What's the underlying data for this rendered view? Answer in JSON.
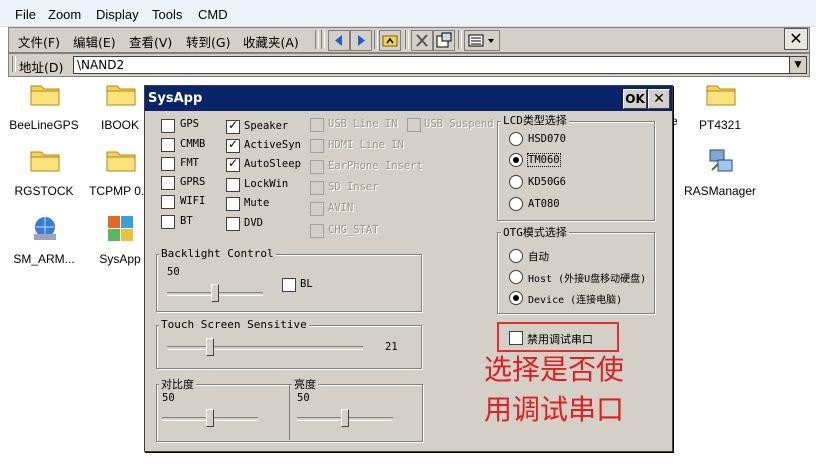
{
  "top_menu": [
    "File",
    "Zoom",
    "Display",
    "Tools",
    "CMD"
  ],
  "explorer": {
    "menu": [
      "文件(F)",
      "编辑(E)",
      "查看(V)",
      "转到(G)",
      "收藏夹(A)"
    ],
    "close_label": "✕",
    "address_label": "地址(D)",
    "address_value": "\\NAND2"
  },
  "desktop_icons": [
    {
      "label": "BeeLineGPS",
      "icon": "folder-icon"
    },
    {
      "label": "IBOOK",
      "icon": "folder-icon"
    },
    {
      "label": "RGSTOCK",
      "icon": "folder-icon"
    },
    {
      "label": "TCPMP 0.8",
      "icon": "folder-icon"
    },
    {
      "label": "SM_ARM...",
      "icon": "network-app-icon"
    },
    {
      "label": "SysApp",
      "icon": "sysapp-icon"
    },
    {
      "label": "PT4321",
      "icon": "folder-icon"
    },
    {
      "label": "RASManager",
      "icon": "ras-network-icon"
    },
    {
      "label": "e",
      "icon": ""
    }
  ],
  "dialog": {
    "title": "SysApp",
    "ok": "OK",
    "close": "✕",
    "checkboxes_col1": [
      {
        "label": "GPS",
        "checked": false
      },
      {
        "label": "CMMB",
        "checked": false
      },
      {
        "label": "FMT",
        "checked": false
      },
      {
        "label": "GPRS",
        "checked": false
      },
      {
        "label": "WIFI",
        "checked": false
      },
      {
        "label": "BT",
        "checked": false
      }
    ],
    "checkboxes_col2": [
      {
        "label": "Speaker",
        "checked": true
      },
      {
        "label": "ActiveSyn",
        "checked": true
      },
      {
        "label": "AutoSleep",
        "checked": true
      },
      {
        "label": "LockWin",
        "checked": false
      },
      {
        "label": "Mute",
        "checked": false
      },
      {
        "label": "DVD",
        "checked": false
      }
    ],
    "checkboxes_col3": [
      {
        "label": "USB Line IN",
        "checked": false,
        "disabled": true
      },
      {
        "label": "HDMI Line IN",
        "checked": false,
        "disabled": true
      },
      {
        "label": "EarPhone Insert",
        "checked": false,
        "disabled": true
      },
      {
        "label": "SD Inser",
        "checked": false,
        "disabled": true
      },
      {
        "label": "AVIN",
        "checked": false,
        "disabled": true
      },
      {
        "label": "CHG_STAT",
        "checked": false,
        "disabled": true
      }
    ],
    "usb_suspend": {
      "label": "USB Suspend",
      "checked": false,
      "disabled": true
    },
    "lcd_group": {
      "title": "LCD类型选择",
      "options": [
        "HSD070",
        "TM060",
        "KD50G6",
        "AT080"
      ],
      "selected": "TM060"
    },
    "otg_group": {
      "title": "OTG模式选择",
      "options": [
        "自动",
        "Host (外接U盘移动硬盘)",
        "Device (连接电脑)"
      ],
      "selected": "Device (连接电脑)"
    },
    "debug_serial": {
      "label": "禁用调试串口",
      "checked": false
    },
    "backlight": {
      "title": "Backlight Control",
      "value": "50",
      "bl_label": "BL",
      "bl_checked": false,
      "level": 50
    },
    "touch": {
      "title": "Touch Screen Sensitive",
      "value": "21",
      "level": 21
    },
    "contrast": {
      "title": "对比度",
      "value": "50",
      "level": 50
    },
    "brightness": {
      "title": "亮度",
      "value": "50",
      "level": 50
    }
  },
  "annotation": {
    "line1": "选择是否使",
    "line2": "用调试串口",
    "color": "#e02020"
  }
}
